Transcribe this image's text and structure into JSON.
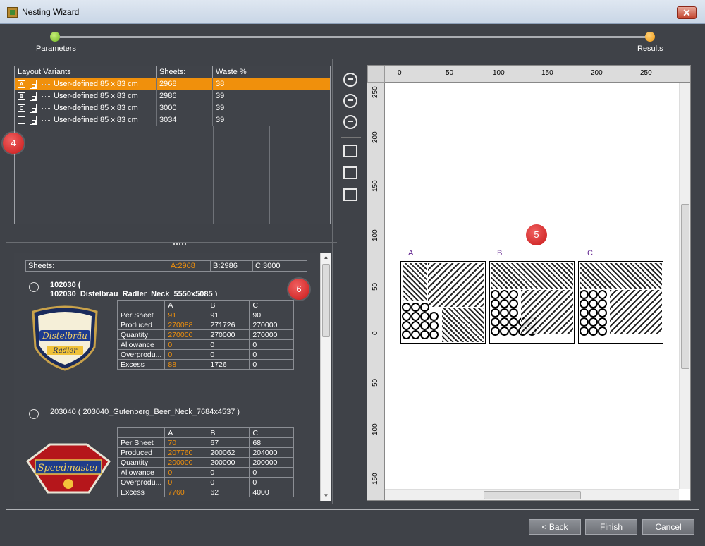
{
  "window": {
    "title": "Nesting Wizard",
    "close": "✕"
  },
  "steps": [
    {
      "label": "Parameters"
    },
    {
      "label": "Results"
    }
  ],
  "variants": {
    "headers": [
      "Layout Variants",
      "Sheets:",
      "Waste %"
    ],
    "rows": [
      {
        "letter": "A",
        "name": "User-defined 85 x 83  cm",
        "sheets": "2968",
        "waste": "38"
      },
      {
        "letter": "B",
        "name": "User-defined 85 x 83  cm",
        "sheets": "2986",
        "waste": "39"
      },
      {
        "letter": "C",
        "name": "User-defined 85 x 83  cm",
        "sheets": "3000",
        "waste": "39"
      },
      {
        "letter": "",
        "name": "User-defined 85 x 83  cm",
        "sheets": "3034",
        "waste": "39"
      }
    ]
  },
  "badges": [
    "4",
    "5",
    "6"
  ],
  "results": {
    "sheets_label": "Sheets:",
    "sheets_a": "A:2968",
    "sheets_b": "B:2986",
    "sheets_c": "C:3000",
    "jobs": [
      {
        "title": "102030 (",
        "subtitle": "102030_Distelbrau_Radler_Neck_5550x5085 )",
        "cols": [
          "A",
          "B",
          "C"
        ],
        "rows": [
          {
            "label": "Per Sheet",
            "a": "91",
            "b": "91",
            "c": "90"
          },
          {
            "label": "Produced",
            "a": "270088",
            "b": "271726",
            "c": "270000"
          },
          {
            "label": "Quantity",
            "a": "270000",
            "b": "270000",
            "c": "270000"
          },
          {
            "label": "Allowance",
            "a": "0",
            "b": "0",
            "c": "0"
          },
          {
            "label": "Overprodu...",
            "a": "0",
            "b": "0",
            "c": "0"
          },
          {
            "label": "Excess",
            "a": "88",
            "b": "1726",
            "c": "0"
          }
        ],
        "label_text": [
          "Distelbräu",
          "Radler"
        ]
      },
      {
        "title": "203040 ( 203040_Gutenberg_Beer_Neck_7684x4537 )",
        "cols": [
          "A",
          "B",
          "C"
        ],
        "rows": [
          {
            "label": "Per Sheet",
            "a": "70",
            "b": "67",
            "c": "68"
          },
          {
            "label": "Produced",
            "a": "207760",
            "b": "200062",
            "c": "204000"
          },
          {
            "label": "Quantity",
            "a": "200000",
            "b": "200000",
            "c": "200000"
          },
          {
            "label": "Allowance",
            "a": "0",
            "b": "0",
            "c": "0"
          },
          {
            "label": "Overprodu...",
            "a": "0",
            "b": "0",
            "c": "0"
          },
          {
            "label": "Excess",
            "a": "7760",
            "b": "62",
            "c": "4000"
          }
        ],
        "label_text": [
          "Speedmaster"
        ]
      }
    ]
  },
  "canvas": {
    "ruler_top": [
      "0",
      "50",
      "100",
      "150",
      "200",
      "250"
    ],
    "ruler_left": [
      "250",
      "200",
      "150",
      "100",
      "50",
      "0",
      "50",
      "100",
      "150"
    ],
    "sheets": [
      "A",
      "B",
      "C"
    ]
  },
  "buttons": {
    "back": "< Back",
    "finish": "Finish",
    "cancel": "Cancel"
  },
  "colors": {
    "accent": "#f0900c",
    "background": "#3f4248"
  }
}
